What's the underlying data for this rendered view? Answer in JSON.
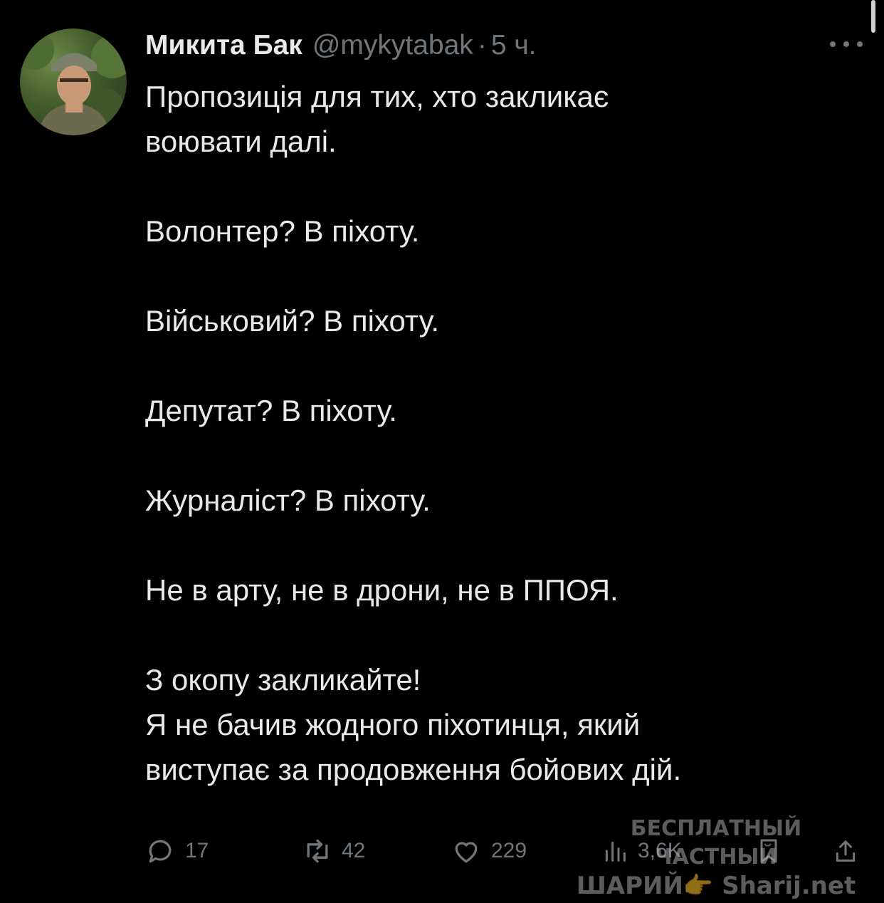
{
  "tweet": {
    "author": {
      "display_name": "Микита Бак",
      "handle": "@mykytabak",
      "separator": "·",
      "time": "5 ч."
    },
    "paragraphs": [
      "Пропозиція для тих, хто закликає\nвоювати далі.",
      "Волонтер? В піхоту.",
      "Військовий? В піхоту.",
      "Депутат? В піхоту.",
      "Журналіст? В піхоту.",
      "Не в арту, не в дрони, не в ППОЯ.",
      "З окопу закликайте!\nЯ не бачив жодного піхотинця, який\nвиступає за продовження бойових дій."
    ],
    "actions": {
      "replies": "17",
      "reposts": "42",
      "likes": "229",
      "views": "3,6K"
    }
  },
  "watermark": {
    "line1": "БЕСПЛАТНЫЙ ЧАСТНЫЙ",
    "line2": "ШАРИЙ👉 Sharij.net"
  },
  "icons": {
    "more": "more-horizontal-icon",
    "reply": "reply-icon",
    "repost": "repost-icon",
    "like": "heart-icon",
    "views": "views-icon",
    "bookmark": "bookmark-icon",
    "share": "share-icon"
  },
  "colors": {
    "background": "#000000",
    "text_primary": "#e7e9ea",
    "text_secondary": "#71767b"
  }
}
